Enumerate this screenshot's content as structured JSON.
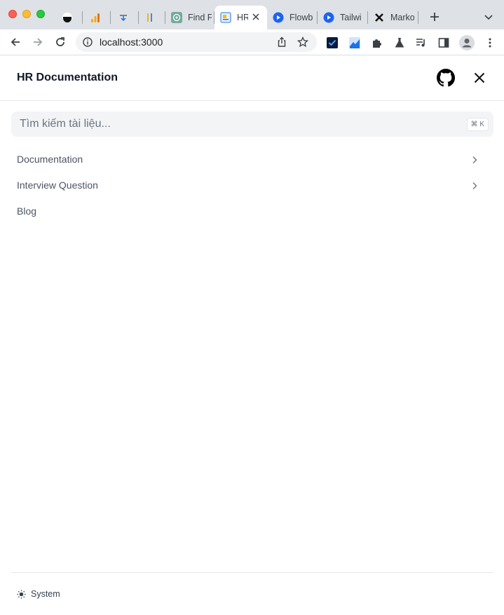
{
  "browser": {
    "tabs": [
      {
        "title": "",
        "icon": "dark-circle-favicon"
      },
      {
        "title": "",
        "icon": "analytics-favicon"
      },
      {
        "title": "",
        "icon": "download-favicon"
      },
      {
        "title": "",
        "icon": "bars-favicon"
      },
      {
        "title": "Find F",
        "icon": "chatgpt-favicon"
      },
      {
        "title": "HR",
        "icon": "doc-favicon",
        "active": true
      },
      {
        "title": "Flowb",
        "icon": "flowbite-favicon"
      },
      {
        "title": "Tailwi",
        "icon": "tailwind-favicon"
      },
      {
        "title": "Marko",
        "icon": "markdown-favicon"
      }
    ],
    "url": "localhost:3000"
  },
  "header": {
    "title": "HR Documentation"
  },
  "search": {
    "placeholder": "Tìm kiếm tài liệu...",
    "shortcut": "⌘ K"
  },
  "nav": {
    "items": [
      {
        "label": "Documentation",
        "has_children": true
      },
      {
        "label": "Interview Question",
        "has_children": true
      },
      {
        "label": "Blog",
        "has_children": false
      }
    ]
  },
  "footer": {
    "theme_label": "System"
  },
  "colors": {
    "chrome_bg": "#dee1e6",
    "accent_blue": "#1a73e8",
    "text_muted": "#4b5563"
  }
}
